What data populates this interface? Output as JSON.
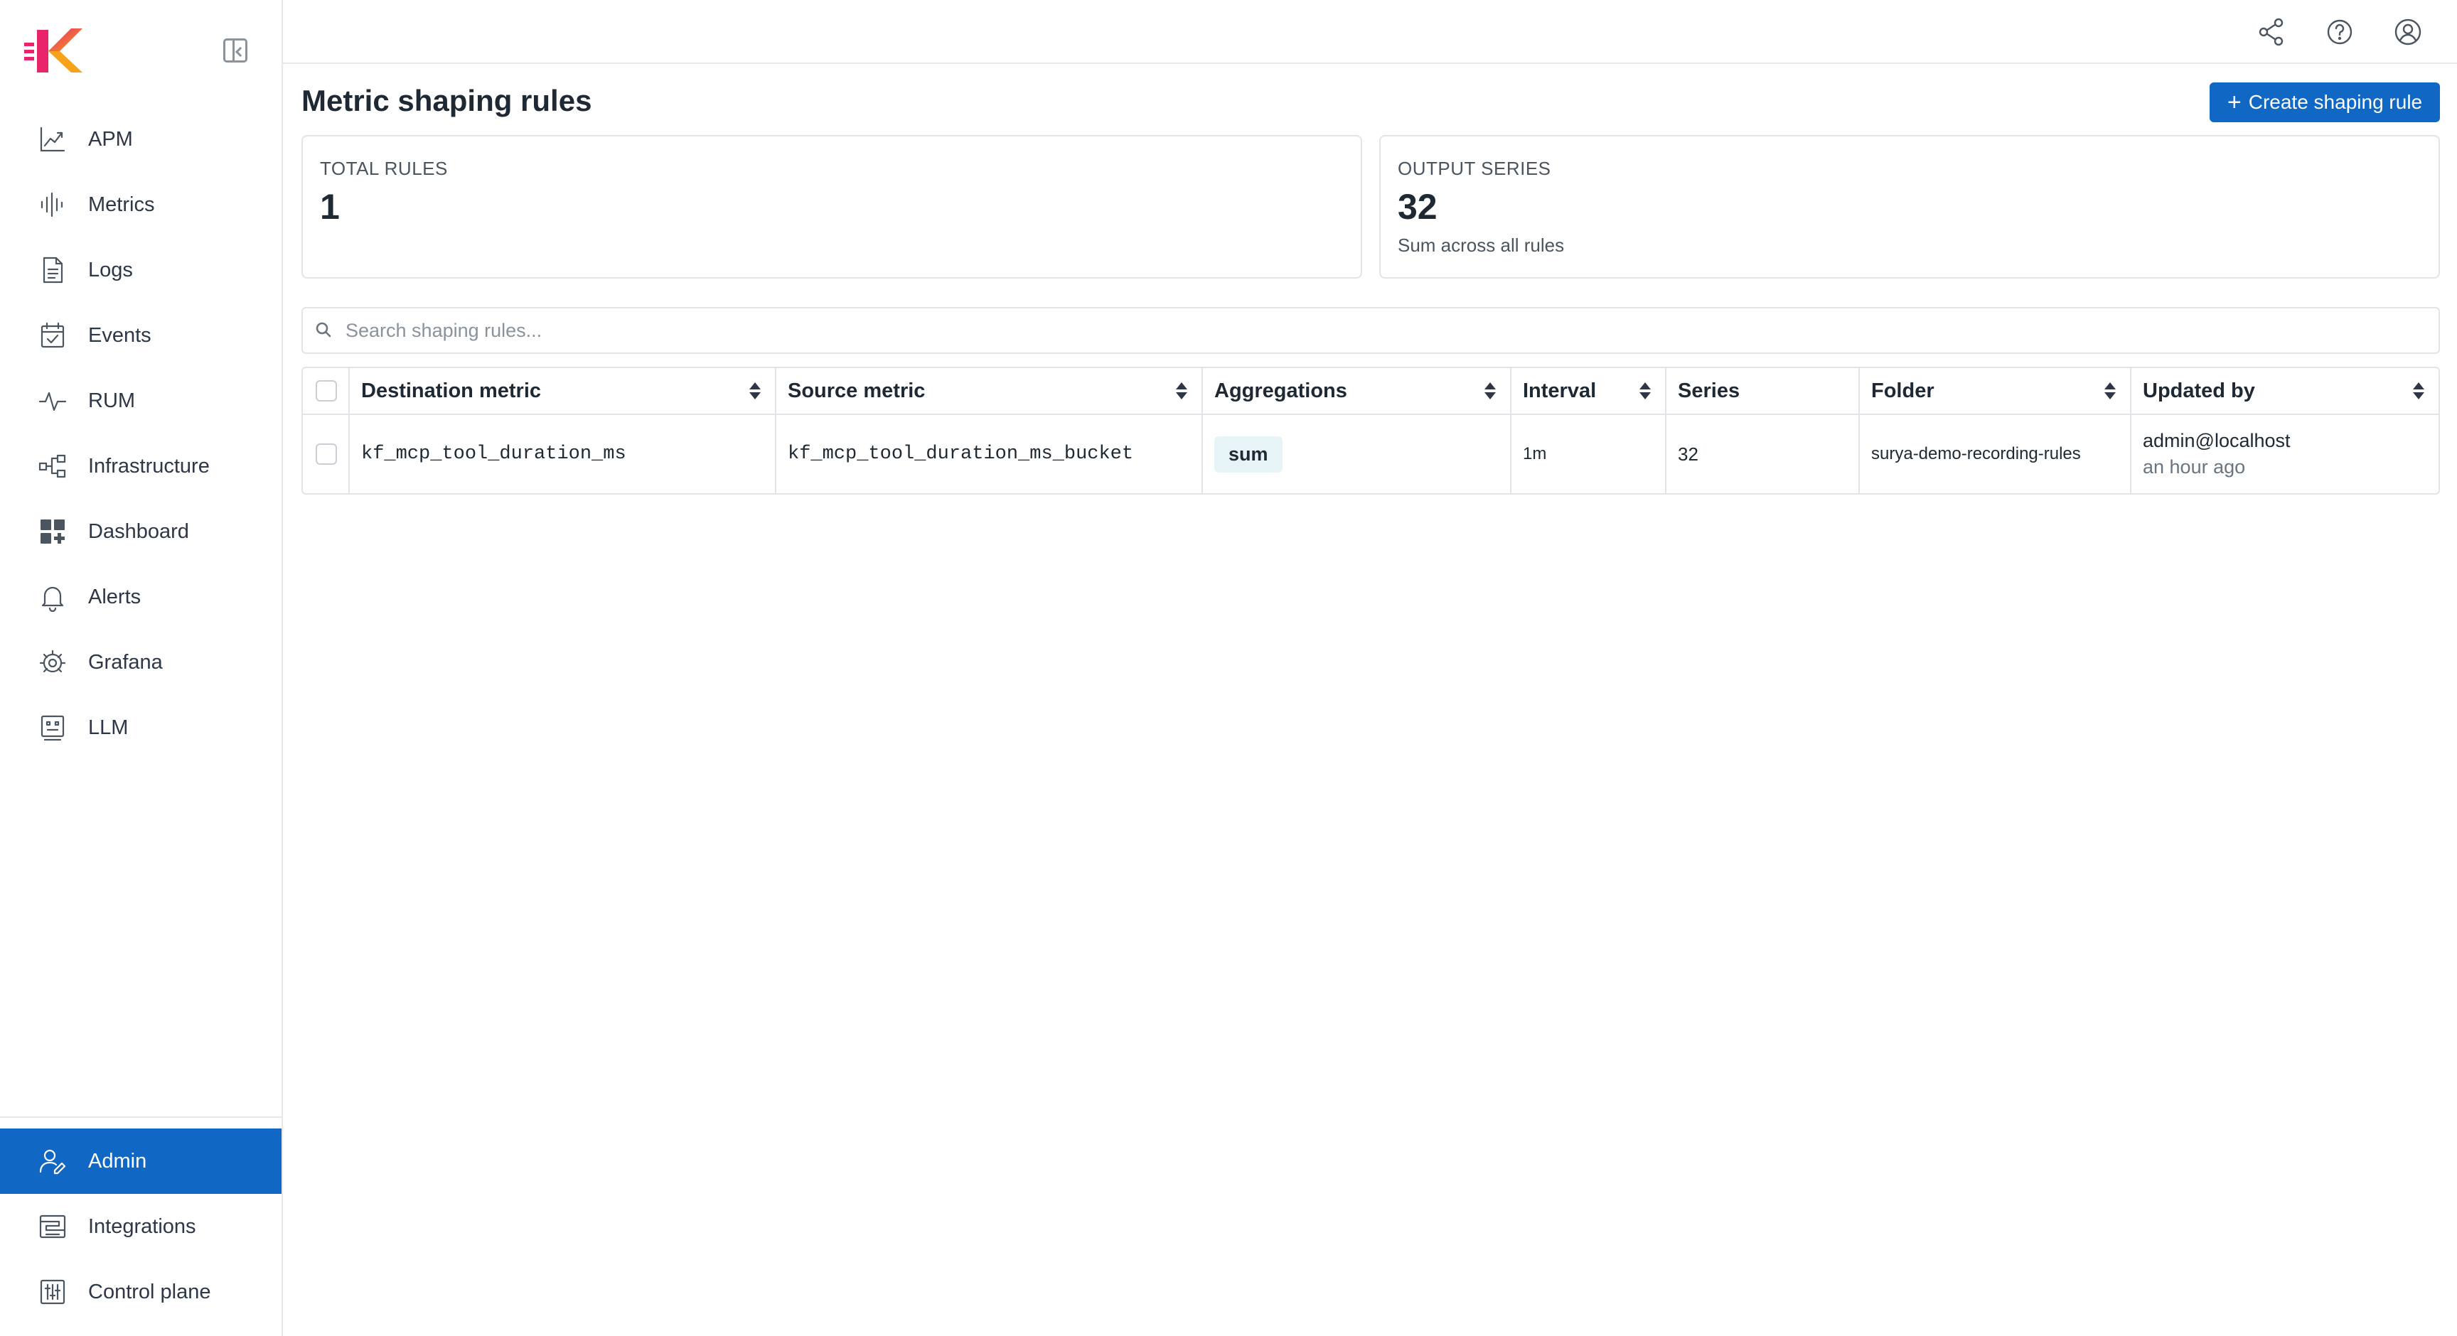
{
  "sidebar": {
    "items": [
      {
        "label": "APM",
        "icon": "apm-chart-icon"
      },
      {
        "label": "Metrics",
        "icon": "metrics-waveform-icon"
      },
      {
        "label": "Logs",
        "icon": "logs-document-icon"
      },
      {
        "label": "Events",
        "icon": "events-calendar-icon"
      },
      {
        "label": "RUM",
        "icon": "rum-pulse-icon"
      },
      {
        "label": "Infrastructure",
        "icon": "infrastructure-network-icon"
      },
      {
        "label": "Dashboard",
        "icon": "dashboard-grid-icon"
      },
      {
        "label": "Alerts",
        "icon": "bell-icon"
      },
      {
        "label": "Grafana",
        "icon": "grafana-gear-icon"
      },
      {
        "label": "LLM",
        "icon": "llm-robot-icon"
      }
    ],
    "bottom_items": [
      {
        "label": "Admin",
        "icon": "admin-user-icon",
        "active": true
      },
      {
        "label": "Integrations",
        "icon": "integrations-icon"
      },
      {
        "label": "Control plane",
        "icon": "control-plane-sliders-icon"
      }
    ]
  },
  "header": {
    "icons": [
      "share-icon",
      "help-icon",
      "user-profile-icon"
    ]
  },
  "page": {
    "title": "Metric shaping rules",
    "create_button": "Create shaping rule"
  },
  "stats": {
    "total_rules": {
      "label": "TOTAL RULES",
      "value": "1"
    },
    "output_series": {
      "label": "OUTPUT SERIES",
      "value": "32",
      "sub": "Sum across all rules"
    }
  },
  "search": {
    "placeholder": "Search shaping rules..."
  },
  "table": {
    "columns": [
      "Destination metric",
      "Source metric",
      "Aggregations",
      "Interval",
      "Series",
      "Folder",
      "Updated by"
    ],
    "rows": [
      {
        "destination": "kf_mcp_tool_duration_ms",
        "source": "kf_mcp_tool_duration_ms_bucket",
        "aggregation": "sum",
        "interval": "1m",
        "series": "32",
        "folder": "surya-demo-recording-rules",
        "updated_by": "admin@localhost",
        "updated_at": "an hour ago"
      }
    ]
  },
  "colors": {
    "accent": "#1068c4",
    "badge_bg": "#e6f4f7"
  }
}
